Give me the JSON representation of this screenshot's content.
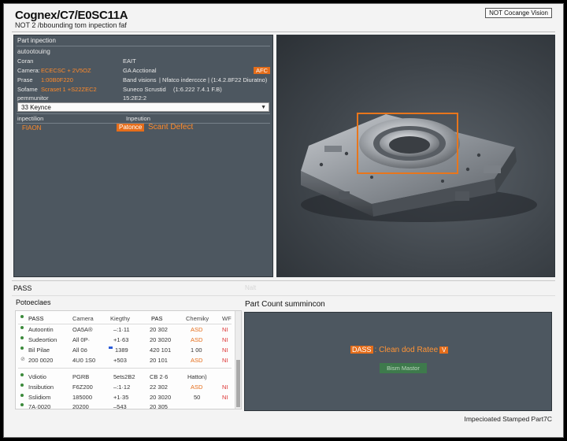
{
  "header": {
    "title": "Cognex/C7/E0SC11A",
    "subtitle": "NOT 2 /bbounding tom inpection faf",
    "badge": "NOT Cocange Vision"
  },
  "left_panel": {
    "header": "Part inpection",
    "section_title": "autootouing",
    "rows": [
      {
        "label": "Coran",
        "value": "",
        "right": "EAIT",
        "right_value": "",
        "chip": ""
      },
      {
        "label": "Camera:",
        "value": "ECECSC + 2V5OZ",
        "right": "GA Acctional",
        "right_value": "",
        "chip": "AFC"
      },
      {
        "label": "Prase",
        "value": "1:00B0F220",
        "right": "Band visions",
        "right_value": "| Nfatco inderccce | (1:4.2.8F22 Diuratno)",
        "chip": ""
      },
      {
        "label": "Sofame",
        "value": "Scraset 1 +S22ZEC2",
        "right": "Suneco Scrustid",
        "right_value": "(1:6.222 7.4.1 F.B)",
        "chip": ""
      }
    ],
    "param_label": "pemmunitor",
    "param_value": "15:2E2:2",
    "select": {
      "value": "33 Keynce"
    },
    "inspection_label": "inpectilion",
    "inspection_right": "Inpeution",
    "result_left": "FIAON",
    "result_button": "Patonce",
    "result_defect": "Scant Defect"
  },
  "image_panel": {
    "alt": "metal part render"
  },
  "band": {
    "pass": "PASS",
    "ghost": "Nalt"
  },
  "table": {
    "title": "Potoeclaes",
    "headers": [
      "PASS",
      "Camera",
      "Kiegthy",
      "PAS",
      "Chemiky",
      "WF"
    ],
    "rows": [
      {
        "c1": "Autoontin",
        "c2": "OA5A®",
        "c3": "–:1·11",
        "c4": "20 302",
        "c5": "ASD",
        "c6": "NI"
      },
      {
        "c1": "Sudeortion",
        "c2": "All 0P·",
        "c3": "+1·63",
        "c4": "20 3020",
        "c5": "ASD",
        "c6": "NI"
      },
      {
        "c1": "Bil Pilae",
        "c2": "All 0ö",
        "c3": "1389",
        "c4": "420 101",
        "c5": "1 00",
        "c6": "NI"
      },
      {
        "c1": "200 0020",
        "c2": "4U0 1S0",
        "c3": "+503",
        "c4": "20 101",
        "c5": "ASD",
        "c6": "NI"
      },
      {
        "c1": "Vdiotio",
        "c2": "PGRB",
        "c3": "5ets2B2",
        "c4": "CB 2·6",
        "c5": "Hatton)",
        "c6": ""
      },
      {
        "c1": "Insibution",
        "c2": "F6Z200",
        "c3": "–:1·12",
        "c4": "22 302",
        "c5": "ASD",
        "c6": "NI"
      },
      {
        "c1": "Sslidiom",
        "c2": "185000",
        "c3": "+1·35",
        "c4": "20 3020",
        "c5": "50",
        "c6": "NI"
      },
      {
        "c1": "7A·0020",
        "c2": "20200",
        "c3": "–543",
        "c4": "20 305",
        "c5": "",
        "c6": ""
      }
    ]
  },
  "summary": {
    "title": "Part Count summincon",
    "pass_chip": "DASS",
    "headline": ": Clean dod Ratee",
    "value_chip": "V",
    "button": "Bism Mastor"
  },
  "footer": {
    "text": "Impecioated Stamped Part7C"
  },
  "colors": {
    "accent": "#e56d1a",
    "panel": "#4d5760",
    "ok": "#3b8a3b"
  }
}
